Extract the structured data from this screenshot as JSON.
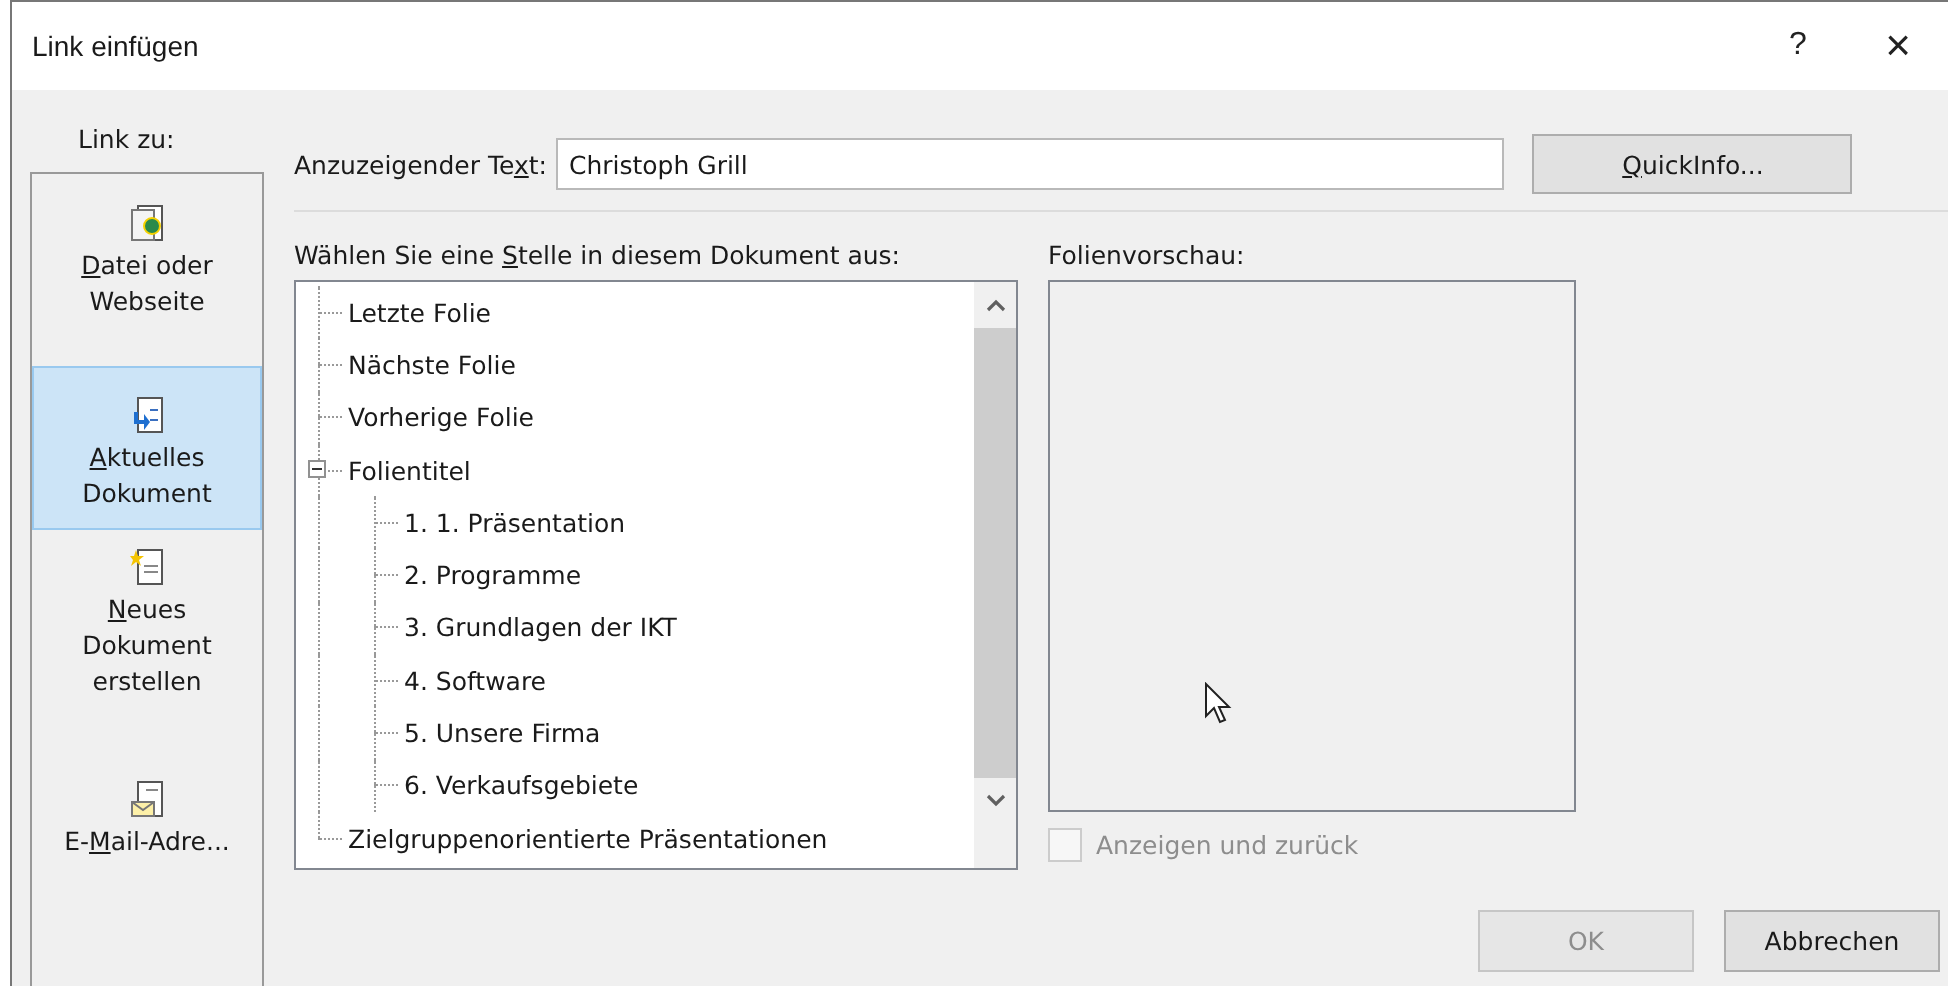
{
  "window": {
    "title": "Link einfügen",
    "help": "?",
    "close": "×"
  },
  "link_to": {
    "label": "Link zu:",
    "items": [
      {
        "key": "D",
        "post": "atei oder Webseite",
        "kind": "file",
        "selected": false
      },
      {
        "key": "A",
        "post": "ktuelles Dokument",
        "kind": "doc",
        "selected": true
      },
      {
        "key": "N",
        "post": "eues Dokument erstellen",
        "kind": "new",
        "selected": false
      },
      {
        "pre": "E-",
        "key": "M",
        "post": "ail-Adre...",
        "kind": "mail",
        "selected": false
      }
    ]
  },
  "display_text": {
    "label_pre": "Anzuzeigender Te",
    "label_key": "x",
    "label_post": "t:",
    "value": "Christoph Grill"
  },
  "quickinfo_button": {
    "key": "Q",
    "post": "uickInfo..."
  },
  "place": {
    "label_pre": "Wählen Sie eine ",
    "label_key": "S",
    "label_post": "telle in diesem Dokument aus:",
    "tree": [
      {
        "label": "Letzte Folie"
      },
      {
        "label": "Nächste Folie"
      },
      {
        "label": "Vorherige Folie"
      },
      {
        "label": "Folientitel",
        "expanded": true,
        "children": [
          {
            "label": "1. 1. Präsentation"
          },
          {
            "label": "2. Programme"
          },
          {
            "label": "3. Grundlagen der IKT"
          },
          {
            "label": "4. Software"
          },
          {
            "label": "5. Unsere Firma"
          },
          {
            "label": "6. Verkaufsgebiete"
          }
        ]
      },
      {
        "label": "Zielgruppenorientierte Präsentationen"
      }
    ]
  },
  "preview": {
    "label": "Folienvorschau:"
  },
  "show_and_return": {
    "label": "Anzeigen und zurück",
    "checked": false,
    "disabled": true
  },
  "buttons": [
    {
      "label": "OK",
      "disabled": true
    },
    {
      "label": "Abbrechen",
      "disabled": false
    }
  ]
}
